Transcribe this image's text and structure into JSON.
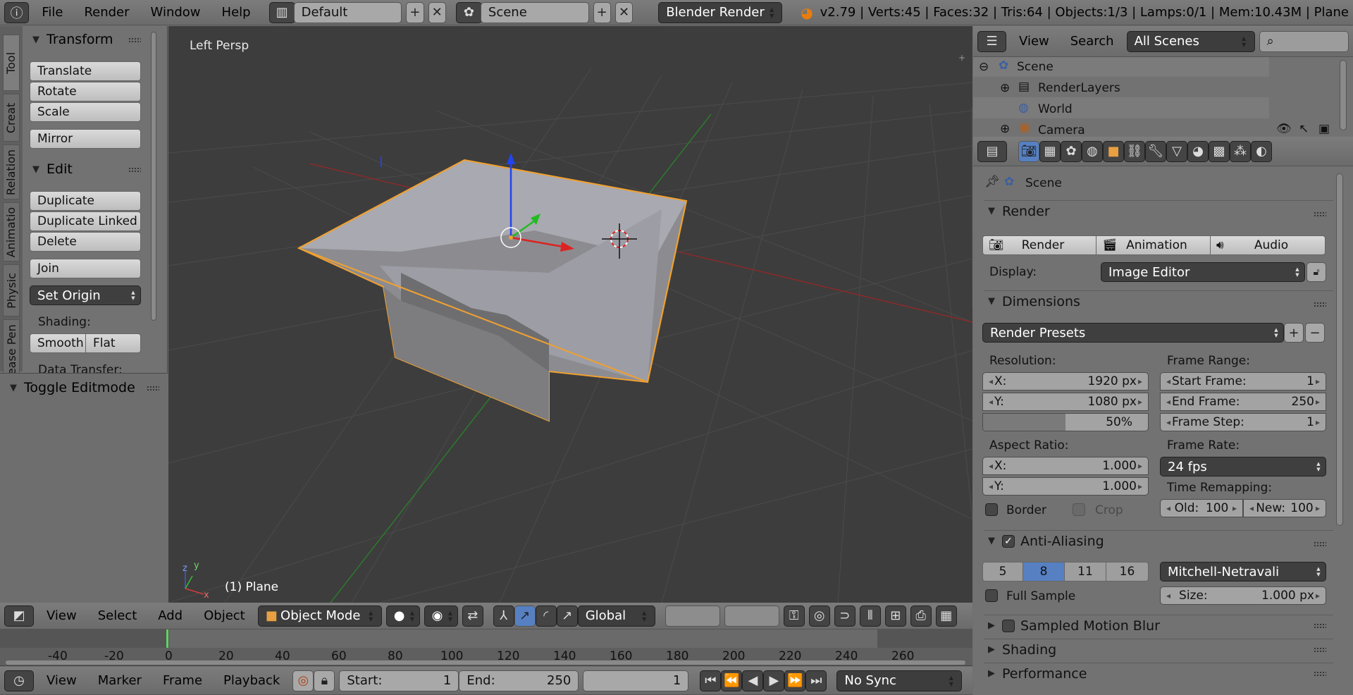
{
  "top_header": {
    "menus": [
      "File",
      "Render",
      "Window",
      "Help"
    ],
    "screen_layout": "Default",
    "scene": "Scene",
    "render_engine": "Blender Render",
    "stats": "v2.79 | Verts:45 | Faces:32 | Tris:64 | Objects:1/3 | Lamps:0/1 | Mem:10.43M | Plane"
  },
  "tool_tabs": [
    "Tool",
    "Creat",
    "Relation",
    "Animatio",
    "Physic",
    "Grease Pen"
  ],
  "transform": {
    "title": "Transform",
    "buttons": [
      "Translate",
      "Rotate",
      "Scale",
      "Mirror"
    ]
  },
  "edit": {
    "title": "Edit",
    "buttons": [
      "Duplicate",
      "Duplicate Linked",
      "Delete",
      "Join"
    ],
    "set_origin": "Set Origin",
    "shading_label": "Shading:",
    "smooth": "Smooth",
    "flat": "Flat",
    "data_transfer": "Data Transfer:"
  },
  "operator": {
    "title": "Toggle Editmode"
  },
  "viewport": {
    "view_name": "Left Persp",
    "object_label": "(1) Plane",
    "axis_x": "x",
    "axis_y": "y",
    "axis_z": "z"
  },
  "view3d_header": {
    "menus": [
      "View",
      "Select",
      "Add",
      "Object"
    ],
    "mode": "Object Mode",
    "orientation": "Global"
  },
  "timeline": {
    "ticks": [
      "-40",
      "-20",
      "0",
      "20",
      "40",
      "60",
      "80",
      "100",
      "120",
      "140",
      "160",
      "180",
      "200",
      "220",
      "240",
      "260"
    ],
    "current_frame": 0,
    "menus": [
      "View",
      "Marker",
      "Frame",
      "Playback"
    ],
    "start_label": "Start:",
    "start": "1",
    "end_label": "End:",
    "end": "250",
    "current": "1",
    "sync": "No Sync"
  },
  "outliner": {
    "menus": [
      "View",
      "Search"
    ],
    "filter": "All Scenes",
    "items": [
      "Scene",
      "RenderLayers",
      "World",
      "Camera"
    ]
  },
  "properties": {
    "context": "Scene",
    "render": {
      "title": "Render",
      "buttons": [
        "Render",
        "Animation",
        "Audio"
      ],
      "display_label": "Display:",
      "display": "Image Editor"
    },
    "dimensions": {
      "title": "Dimensions",
      "presets": "Render Presets",
      "resolution_label": "Resolution:",
      "res_x_label": "X:",
      "res_x": "1920 px",
      "res_y_label": "Y:",
      "res_y": "1080 px",
      "res_pct": "50%",
      "res_pct_value": 0.5,
      "frame_range_label": "Frame Range:",
      "start_label": "Start Frame:",
      "start": "1",
      "end_label": "End Frame:",
      "end": "250",
      "step_label": "Frame Step:",
      "step": "1",
      "aspect_label": "Aspect Ratio:",
      "asp_x_label": "X:",
      "asp_x": "1.000",
      "asp_y_label": "Y:",
      "asp_y": "1.000",
      "frame_rate_label": "Frame Rate:",
      "frame_rate": "24 fps",
      "remap_label": "Time Remapping:",
      "old_label": "Old:",
      "old": "100",
      "new_label": "New:",
      "new": "100",
      "border": "Border",
      "crop": "Crop"
    },
    "aa": {
      "title": "Anti-Aliasing",
      "samples": [
        "5",
        "8",
        "11",
        "16"
      ],
      "active": "8",
      "filter": "Mitchell-Netravali",
      "full_sample": "Full Sample",
      "size_label": "Size:",
      "size": "1.000 px"
    },
    "collapsed": [
      "Sampled Motion Blur",
      "Shading",
      "Performance"
    ]
  },
  "colors": {
    "accent": "#5680c2",
    "selection": "#f0a030",
    "viewport_bg": "#3d3d3d"
  }
}
